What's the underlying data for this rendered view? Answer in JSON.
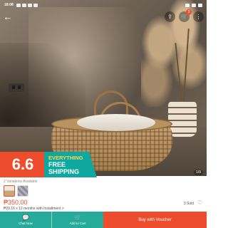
{
  "status_bar": {
    "time": "18:08"
  },
  "top_bar": {
    "back_icon": "arrow-left-icon",
    "share_icon": "share-icon",
    "cart_icon": "cart-icon",
    "cart_badge": "3",
    "more_icon": "more-icon"
  },
  "image": {
    "counter": "1/9"
  },
  "promo": {
    "date": "6.6",
    "line1": "EVERYTHING",
    "line2": "FREE",
    "line3": "SHIPPING",
    "colors": {
      "red": "#ee4d2d",
      "teal": "#0fa8a0",
      "yellow": "#ffd84a"
    }
  },
  "product": {
    "variations_label": "2 Variations Available",
    "price": "₱350.00",
    "installment": "₱29.16 x 12 months with",
    "installment_link": "Installment >",
    "sold": "3 Sold"
  },
  "bottom_bar": {
    "chat_label": "Chat Now",
    "cart_label": "Add to Cart",
    "buy_label": "Buy with Voucher",
    "colors": {
      "teal": "#26aa99",
      "orange": "#ee4d2d"
    }
  }
}
